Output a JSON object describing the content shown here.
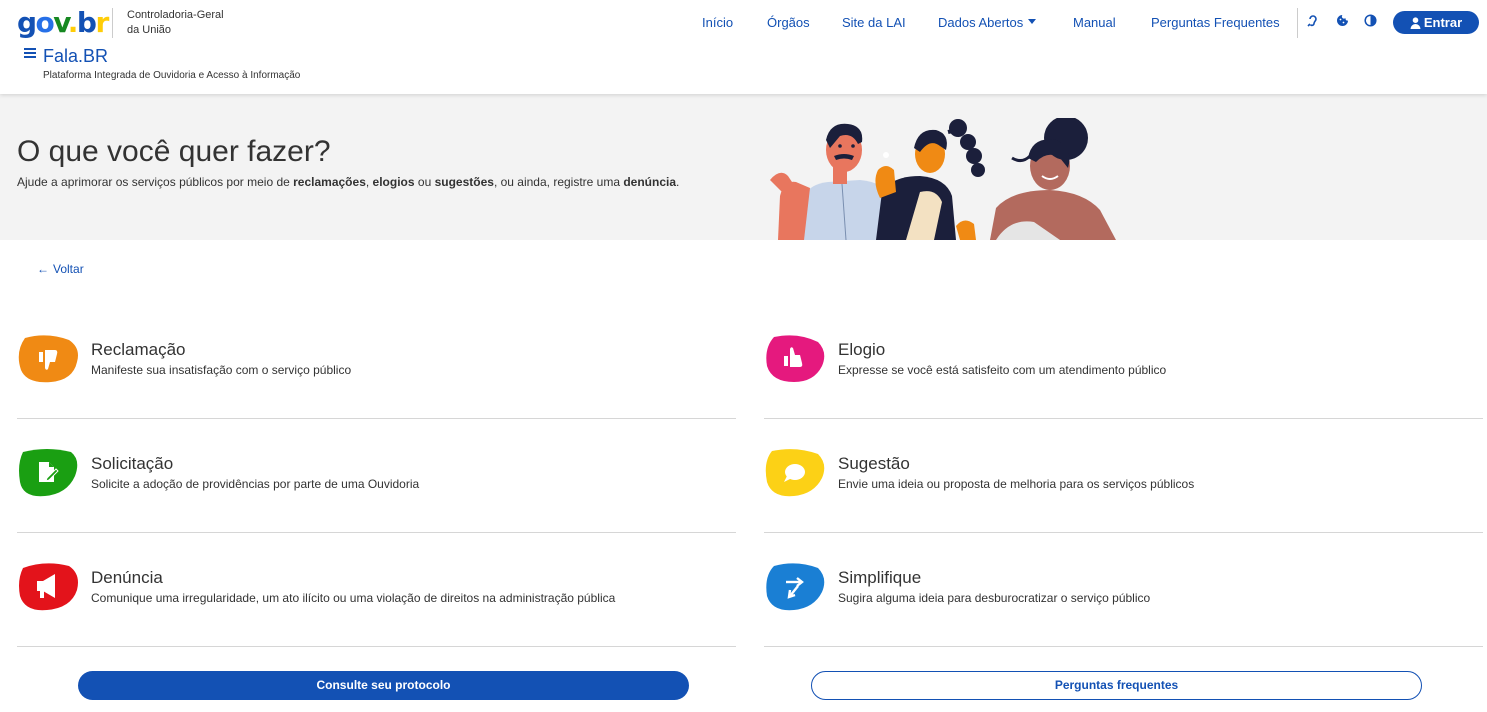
{
  "header": {
    "logo": {
      "g": "g",
      "o": "o",
      "v": "v",
      "dot": ".",
      "b": "b",
      "r": "r"
    },
    "org_name": "Controladoria-Geral da União",
    "nav": [
      {
        "label": "Início"
      },
      {
        "label": "Órgãos"
      },
      {
        "label": "Site da LAI"
      },
      {
        "label": "Dados Abertos"
      },
      {
        "label": "Manual"
      },
      {
        "label": "Perguntas Frequentes"
      }
    ],
    "login_label": "Entrar",
    "app_title": "Fala.BR",
    "app_subtitle": "Plataforma Integrada de Ouvidoria e Acesso à Informação"
  },
  "hero": {
    "title": "O que você quer fazer?",
    "desc_parts": [
      "Ajude a aprimorar os serviços públicos por meio de ",
      "reclamações",
      ", ",
      "elogios",
      " ou ",
      "sugestões",
      ", ou ainda, registre uma ",
      "denúncia",
      "."
    ]
  },
  "back_label": "Voltar",
  "options": [
    {
      "name": "Reclamação",
      "desc": "Manifeste sua insatisfação com o serviço público",
      "color": "#f08a14",
      "icon": "thumbs-down-icon"
    },
    {
      "name": "Elogio",
      "desc": "Expresse se você está satisfeito com um atendimento público",
      "color": "#e5197e",
      "icon": "thumbs-up-icon"
    },
    {
      "name": "Solicitação",
      "desc": "Solicite a adoção de providências por parte de uma Ouvidoria",
      "color": "#1a9f12",
      "icon": "document-edit-icon"
    },
    {
      "name": "Sugestão",
      "desc": "Envie uma ideia ou proposta de melhoria para os serviços públicos",
      "color": "#fcd116",
      "icon": "chat-bubble-icon"
    },
    {
      "name": "Denúncia",
      "desc": "Comunique uma irregularidade, um ato ilícito ou uma violação de direitos na administração pública",
      "color": "#e3131b",
      "icon": "megaphone-icon"
    },
    {
      "name": "Simplifique",
      "desc": "Sugira alguma ideia para desburocratizar o serviço público",
      "color": "#1a7fd4",
      "icon": "arrows-icon"
    }
  ],
  "buttons": {
    "protocol": "Consulte seu protocolo",
    "faq": "Perguntas frequentes"
  },
  "colors": {
    "primary": "#1351b4",
    "hero_bg": "#f3f3f3"
  }
}
